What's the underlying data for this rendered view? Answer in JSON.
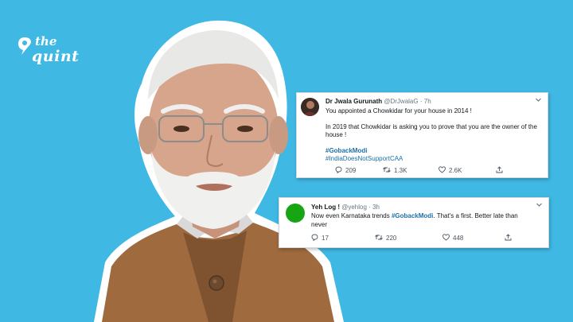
{
  "brand": {
    "line1": "the",
    "line2": "quint"
  },
  "tweets": [
    {
      "name": "Dr Jwala Gurunath",
      "handle": "@DrJwalaG",
      "time": "7h",
      "line1": "You appointed a Chowkidar for your house in 2014 !",
      "line2": "In 2019 that Chowkidar is asking you to prove that you are the owner of the",
      "line3": "house !",
      "tag1": "#GobackModi",
      "tag2": "#IndiaDoesNotSupportCAA",
      "replies": "209",
      "retweets": "1.3K",
      "likes": "2.6K"
    },
    {
      "name": "Yeh Log !",
      "handle": "@yehlog",
      "time": "3h",
      "text_before": "Now even Karnataka trends ",
      "tag": "#GobackModi",
      "text_after": ". That's a first. Better late than",
      "text_line2": "never",
      "replies": "17",
      "retweets": "220",
      "likes": "448"
    }
  ],
  "colors": {
    "background": "#3fb8e3",
    "hashtag": "#1b6fa8",
    "avatar_green": "#18a513"
  },
  "icons": [
    "quint-logo-icon",
    "reply-icon",
    "retweet-icon",
    "like-icon",
    "share-icon",
    "chevron-down-icon"
  ]
}
